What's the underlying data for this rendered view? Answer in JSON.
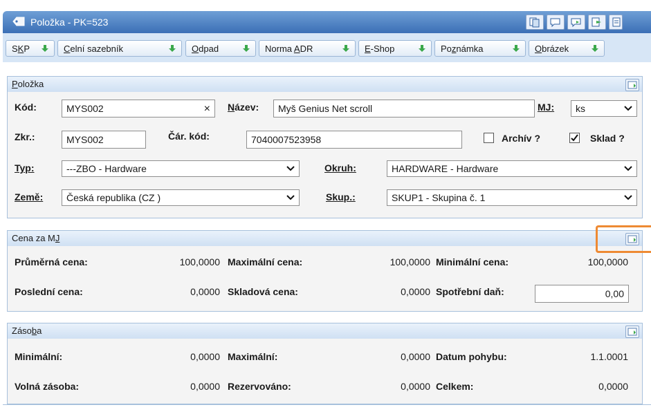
{
  "window": {
    "title": "Položka - PK=523"
  },
  "tabs": [
    {
      "prefix": "S",
      "accel": "K",
      "suffix": "P"
    },
    {
      "prefix": "",
      "accel": "C",
      "suffix": "elní sazebník"
    },
    {
      "prefix": "",
      "accel": "O",
      "suffix": "dpad"
    },
    {
      "prefix": "Norma ",
      "accel": "A",
      "suffix": "DR"
    },
    {
      "prefix": "",
      "accel": "E",
      "suffix": "-Shop"
    },
    {
      "prefix": "Po",
      "accel": "z",
      "suffix": "námka"
    },
    {
      "prefix": "",
      "accel": "O",
      "suffix": "brázek"
    }
  ],
  "polozka": {
    "header_accel": "P",
    "header_rest": "oložka",
    "kod_label": "Kód:",
    "kod_value": "MYS002",
    "nazev_accel": "N",
    "nazev_rest": "ázev:",
    "nazev_value": "Myš Genius Net scroll",
    "mj_label": "MJ:",
    "mj_value": "ks",
    "zkr_label": "Zkr.:",
    "zkr_value": "MYS002",
    "car_kod_label": "Čár. kód:",
    "car_kod_value": "7040007523958",
    "archiv_label": "Archív ?",
    "archiv_checked": false,
    "sklad_label": "Sklad ?",
    "sklad_checked": true,
    "typ_label": "Typ:",
    "typ_value": "---ZBO - Hardware",
    "okruh_label": "Okruh:",
    "okruh_value": "HARDWARE - Hardware",
    "zeme_label": "Země:",
    "zeme_value": "Česká republika (CZ )",
    "skup_label": "Skup.:",
    "skup_value": "SKUP1 - Skupina č. 1"
  },
  "cena": {
    "header_prefix": "Cena za M",
    "header_accel": "J",
    "prumerna_label": "Průměrná cena:",
    "prumerna_value": "100,0000",
    "maximalni_label": "Maximální cena:",
    "maximalni_value": "100,0000",
    "minimalni_label": "Minimální cena:",
    "minimalni_value": "100,0000",
    "posledni_label": "Poslední cena:",
    "posledni_value": "0,0000",
    "skladova_label": "Skladová cena:",
    "skladova_value": "0,0000",
    "spotrebni_label": "Spotřební daň:",
    "spotrebni_value": "0,00"
  },
  "zasoba": {
    "header_prefix": "Záso",
    "header_accel": "b",
    "header_rest": "a",
    "minimalni_label": "Minimální:",
    "minimalni_value": "0,0000",
    "maximalni_label": "Maximální:",
    "maximalni_value": "0,0000",
    "datum_label": "Datum pohybu:",
    "datum_value": "1.1.0001",
    "volna_label": "Volná zásoba:",
    "volna_value": "0,0000",
    "rezervovano_label": "Rezervováno:",
    "rezervovano_value": "0,0000",
    "celkem_label": "Celkem:",
    "celkem_value": "0,0000"
  },
  "colors": {
    "titlebar": "#3b6fb6",
    "panel_border": "#a7c0dc",
    "highlight": "#ee8a33",
    "arrow_green": "#3aa84a"
  }
}
